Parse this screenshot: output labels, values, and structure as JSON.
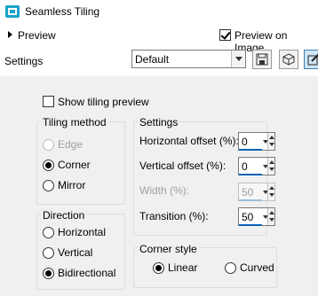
{
  "window": {
    "title": "Seamless Tiling"
  },
  "preview_row": {
    "label": "Preview",
    "preview_on_image_label": "Preview on Image",
    "preview_on_image_checked": true
  },
  "settings_row": {
    "label": "Settings",
    "preset_value": "Default"
  },
  "show_tiling_preview": {
    "label": "Show tiling preview",
    "checked": false
  },
  "tiling_method": {
    "title": "Tiling method",
    "options": [
      {
        "label": "Edge",
        "selected": false,
        "disabled": true
      },
      {
        "label": "Corner",
        "selected": true,
        "disabled": false
      },
      {
        "label": "Mirror",
        "selected": false,
        "disabled": false
      }
    ]
  },
  "direction": {
    "title": "Direction",
    "options": [
      {
        "label": "Horizontal",
        "selected": false
      },
      {
        "label": "Vertical",
        "selected": false
      },
      {
        "label": "Bidirectional",
        "selected": true
      }
    ]
  },
  "settings_group": {
    "title": "Settings",
    "horizontal_offset": {
      "label": "Horizontal offset (%):",
      "value": "0"
    },
    "vertical_offset": {
      "label": "Vertical offset (%):",
      "value": "0"
    },
    "width": {
      "label": "Width (%):",
      "value": "50",
      "disabled": true
    },
    "transition": {
      "label": "Transition (%):",
      "value": "50"
    }
  },
  "corner_style": {
    "title": "Corner style",
    "options": [
      {
        "label": "Linear",
        "selected": true
      },
      {
        "label": "Curved",
        "selected": false
      }
    ]
  },
  "colors": {
    "panel_bg": "#f0f0f0",
    "accent": "#0a64b4",
    "disabled_text": "#a0a0a0"
  }
}
